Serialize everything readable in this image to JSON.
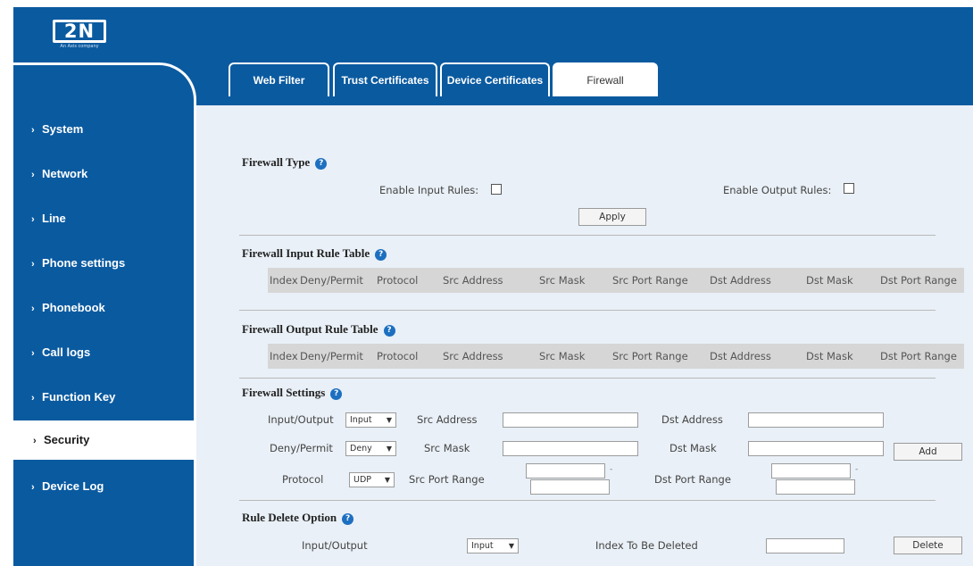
{
  "brand": {
    "logo_text": "2N",
    "logo_sub": "An Axis company"
  },
  "sidebar": {
    "items": [
      {
        "label": "System"
      },
      {
        "label": "Network"
      },
      {
        "label": "Line"
      },
      {
        "label": "Phone settings"
      },
      {
        "label": "Phonebook"
      },
      {
        "label": "Call logs"
      },
      {
        "label": "Function Key"
      },
      {
        "label": "Security"
      },
      {
        "label": "Device Log"
      }
    ],
    "active": "Security"
  },
  "tabs": [
    {
      "label": "Web Filter"
    },
    {
      "label": "Trust Certificates"
    },
    {
      "label": "Device Certificates"
    },
    {
      "label": "Firewall"
    }
  ],
  "firewall_type": {
    "title": "Firewall Type",
    "enable_input_label": "Enable Input Rules:",
    "enable_output_label": "Enable Output Rules:",
    "apply_label": "Apply"
  },
  "input_table": {
    "title": "Firewall Input Rule Table",
    "columns": [
      "Index",
      "Deny/Permit",
      "Protocol",
      "Src Address",
      "Src Mask",
      "Src Port Range",
      "Dst Address",
      "Dst Mask",
      "Dst Port Range"
    ]
  },
  "output_table": {
    "title": "Firewall Output Rule Table",
    "columns": [
      "Index",
      "Deny/Permit",
      "Protocol",
      "Src Address",
      "Src Mask",
      "Src Port Range",
      "Dst Address",
      "Dst Mask",
      "Dst Port Range"
    ]
  },
  "settings": {
    "title": "Firewall Settings",
    "input_output_label": "Input/Output",
    "input_output_value": "Input",
    "deny_permit_label": "Deny/Permit",
    "deny_permit_value": "Deny",
    "protocol_label": "Protocol",
    "protocol_value": "UDP",
    "src_address_label": "Src Address",
    "src_mask_label": "Src Mask",
    "src_port_range_label": "Src Port Range",
    "dst_address_label": "Dst Address",
    "dst_mask_label": "Dst Mask",
    "dst_port_range_label": "Dst Port Range",
    "range_separator": "-",
    "add_label": "Add"
  },
  "rule_delete": {
    "title": "Rule Delete Option",
    "input_output_label": "Input/Output",
    "input_output_value": "Input",
    "index_label": "Index To Be Deleted",
    "delete_label": "Delete"
  },
  "colors": {
    "brand_blue": "#0a5aa0",
    "content_bg": "#e9f0f7",
    "help_icon": "#1d6fc0"
  },
  "icons": {
    "help": "question-circle-icon",
    "chevron": "chevron-right-icon",
    "dropdown": "chevron-down-icon"
  }
}
